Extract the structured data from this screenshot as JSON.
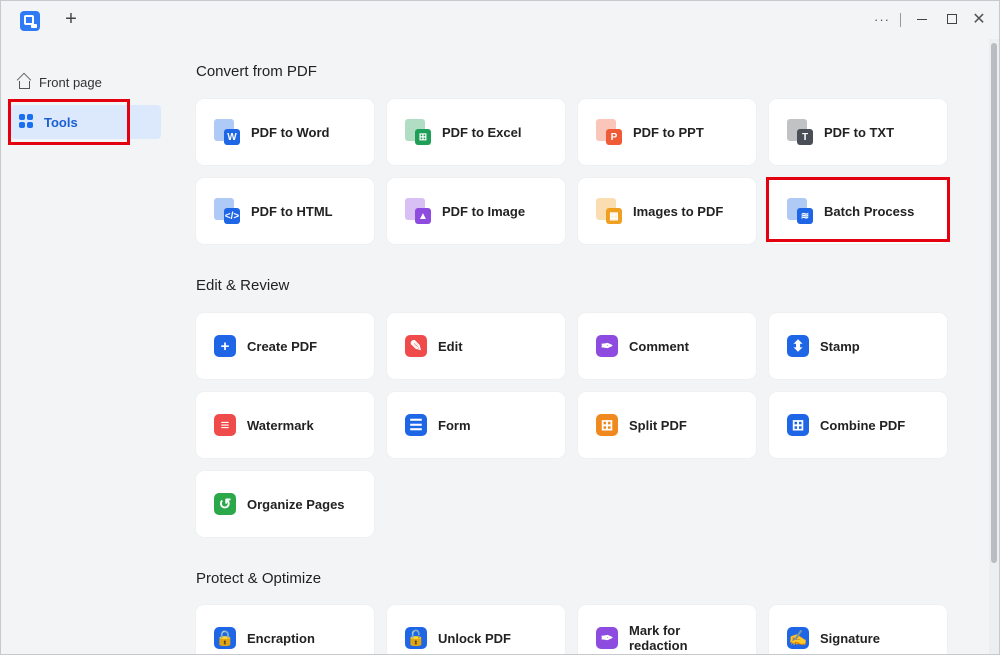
{
  "titlebar": {
    "add_tab": "+",
    "more": "···",
    "close": "✕"
  },
  "sidebar": {
    "items": [
      {
        "label": "Front page"
      },
      {
        "label": "Tools"
      }
    ]
  },
  "sections": [
    {
      "title": "Convert from PDF"
    },
    {
      "title": "Edit & Review"
    },
    {
      "title": "Protect & Optimize"
    }
  ],
  "convert": [
    {
      "label": "PDF to Word",
      "glyph": "W",
      "color": "#1e66e6"
    },
    {
      "label": "PDF to Excel",
      "glyph": "⊞",
      "color": "#1f9e57"
    },
    {
      "label": "PDF to PPT",
      "glyph": "P",
      "color": "#ef5b37"
    },
    {
      "label": "PDF to TXT",
      "glyph": "T",
      "color": "#4a4f57"
    },
    {
      "label": "PDF to HTML",
      "glyph": "</>",
      "color": "#1e66e6"
    },
    {
      "label": "PDF to Image",
      "glyph": "▲",
      "color": "#8e4be0"
    },
    {
      "label": "Images to PDF",
      "glyph": "▦",
      "color": "#f0a020"
    },
    {
      "label": "Batch Process",
      "glyph": "≋",
      "color": "#1e66e6"
    }
  ],
  "edit": [
    {
      "label": "Create PDF",
      "glyph": "+",
      "color": "#1e66e6"
    },
    {
      "label": "Edit",
      "glyph": "✎",
      "color": "#ef4b4b"
    },
    {
      "label": "Comment",
      "glyph": "✒",
      "color": "#8e4be0"
    },
    {
      "label": "Stamp",
      "glyph": "⬍",
      "color": "#1e66e6"
    },
    {
      "label": "Watermark",
      "glyph": "≡",
      "color": "#ef4b4b"
    },
    {
      "label": "Form",
      "glyph": "☰",
      "color": "#1e66e6"
    },
    {
      "label": "Split PDF",
      "glyph": "⊞",
      "color": "#f08a20"
    },
    {
      "label": "Combine PDF",
      "glyph": "⊞",
      "color": "#1e66e6"
    },
    {
      "label": "Organize Pages",
      "glyph": "↺",
      "color": "#2aa84a"
    }
  ],
  "protect": [
    {
      "label": "Encraption",
      "glyph": "🔒",
      "color": "#1e66e6"
    },
    {
      "label": "Unlock PDF",
      "glyph": "🔓",
      "color": "#1e66e6"
    },
    {
      "label": "Mark for redaction",
      "glyph": "✒",
      "color": "#8e4be0"
    },
    {
      "label": "Signature",
      "glyph": "✍",
      "color": "#1e66e6"
    }
  ]
}
